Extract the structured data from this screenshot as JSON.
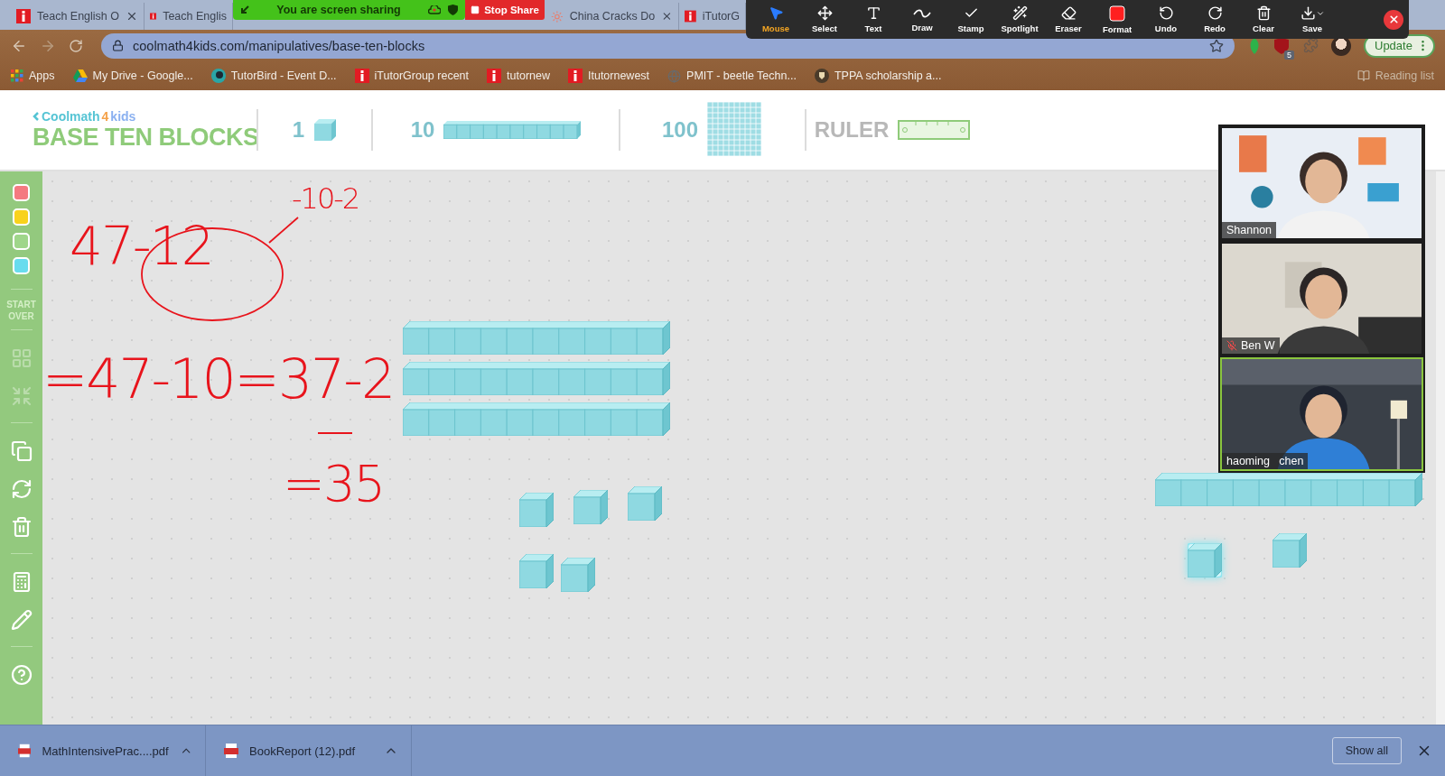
{
  "browser": {
    "tabs": [
      {
        "title": "Teach English O",
        "kind": "itutor"
      },
      {
        "title": "Teach Englis",
        "kind": "itutor"
      },
      {
        "title": "China Cracks Do",
        "kind": "sun"
      },
      {
        "title": "iTutorG",
        "kind": "itutor"
      }
    ],
    "url": "coolmath4kids.com/manipulatives/base-ten-blocks",
    "extension_badge": "5",
    "update": "Update",
    "bookmarks": [
      {
        "label": "Apps",
        "kind": "apps"
      },
      {
        "label": "My Drive - Google...",
        "kind": "drive"
      },
      {
        "label": "TutorBird - Event D...",
        "kind": "bird"
      },
      {
        "label": "iTutorGroup recent",
        "kind": "itutor"
      },
      {
        "label": "tutornew",
        "kind": "itutor"
      },
      {
        "label": "Itutornewest",
        "kind": "itutor"
      },
      {
        "label": "PMIT - beetle Techn...",
        "kind": "globe"
      },
      {
        "label": "TPPA scholarship a...",
        "kind": "crest"
      }
    ],
    "reading_list": "Reading list"
  },
  "share_banner": {
    "message": "You are screen sharing",
    "stop": "Stop Share"
  },
  "annotate_toolbar": {
    "tools": [
      {
        "kind": "mouse",
        "label": "Mouse",
        "selected": true
      },
      {
        "kind": "select",
        "label": "Select",
        "selected": false
      },
      {
        "kind": "text",
        "label": "Text",
        "selected": false
      },
      {
        "kind": "draw",
        "label": "Draw",
        "selected": false
      },
      {
        "kind": "stamp",
        "label": "Stamp",
        "selected": false
      },
      {
        "kind": "spotlight",
        "label": "Spotlight",
        "selected": false
      },
      {
        "kind": "eraser",
        "label": "Eraser",
        "selected": false
      },
      {
        "kind": "format",
        "label": "Format",
        "selected": false
      },
      {
        "kind": "undo",
        "label": "Undo",
        "selected": false
      },
      {
        "kind": "redo",
        "label": "Redo",
        "selected": false
      },
      {
        "kind": "clear",
        "label": "Clear",
        "selected": false
      },
      {
        "kind": "save",
        "label": "Save",
        "selected": false
      }
    ]
  },
  "app": {
    "logo": {
      "prefix": "Coolmath",
      "digit": "4",
      "suffix": "kids"
    },
    "title": "BASE TEN BLOCKS",
    "tray": [
      {
        "kind": "cube",
        "label": "1"
      },
      {
        "kind": "rod",
        "label": "10"
      },
      {
        "kind": "flat",
        "label": "100"
      },
      {
        "kind": "ruler",
        "label": "RULER"
      }
    ],
    "sidebar": {
      "colors": [
        {
          "color": "#f47a80"
        },
        {
          "color": "#f8d21c"
        },
        {
          "color": "#9fd68a"
        },
        {
          "color": "#68dcee"
        }
      ],
      "start_over": "START OVER",
      "tool_groups": [
        [
          {
            "kind": "add_grid",
            "disabled": true
          },
          {
            "kind": "shrink",
            "disabled": true
          }
        ],
        [
          {
            "kind": "duplicate",
            "disabled": false
          },
          {
            "kind": "rotate",
            "disabled": false
          },
          {
            "kind": "trash",
            "disabled": false
          }
        ],
        [
          {
            "kind": "calculator",
            "disabled": false
          },
          {
            "kind": "pencil",
            "disabled": false
          }
        ],
        [
          {
            "kind": "help",
            "disabled": false
          }
        ]
      ]
    },
    "annotations": [
      {
        "text": "-10-2"
      },
      {
        "text": "47-12"
      },
      {
        "text": "=47-10=37-2"
      },
      {
        "text": "=35"
      }
    ],
    "blocks": [
      {
        "kind": "rod",
        "selected": false
      },
      {
        "kind": "rod",
        "selected": false
      },
      {
        "kind": "rod",
        "selected": false
      },
      {
        "kind": "cube",
        "selected": false
      },
      {
        "kind": "cube",
        "selected": false
      },
      {
        "kind": "cube",
        "selected": false
      },
      {
        "kind": "cube",
        "selected": false
      },
      {
        "kind": "cube",
        "selected": false
      },
      {
        "kind": "rod",
        "selected": false
      },
      {
        "kind": "cube",
        "selected": true
      },
      {
        "kind": "cube",
        "selected": false
      }
    ]
  },
  "video": {
    "participants": [
      {
        "name": "Shannon",
        "muted": false,
        "active": false
      },
      {
        "name": "Ben W",
        "muted": true,
        "active": false
      },
      {
        "name": "haoming   chen",
        "muted": false,
        "active": true
      }
    ]
  },
  "downloads": {
    "files": [
      {
        "name": "MathIntensivePrac....pdf"
      },
      {
        "name": "BookReport (12).pdf"
      }
    ],
    "show_all": "Show all"
  }
}
